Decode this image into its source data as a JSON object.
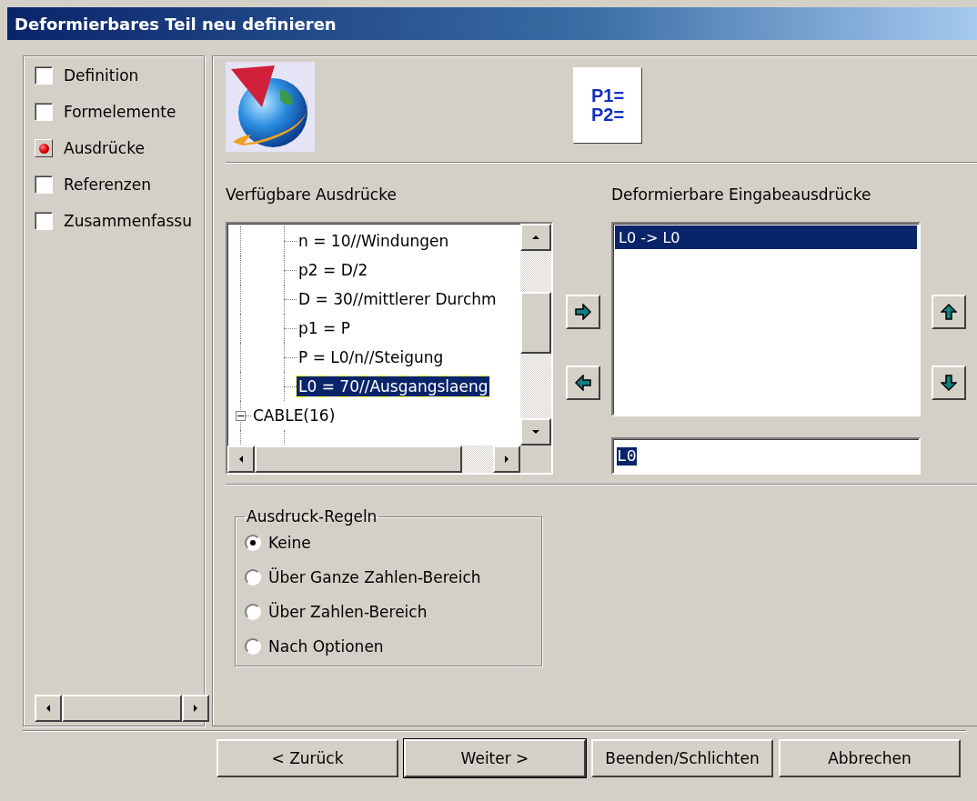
{
  "window": {
    "title": "Deformierbares Teil neu definieren"
  },
  "parameter_icon": [
    "P1=",
    "P2="
  ],
  "steps": [
    {
      "label": "Definition",
      "selected": false
    },
    {
      "label": "Formelemente",
      "selected": false
    },
    {
      "label": "Ausdrücke",
      "selected": true
    },
    {
      "label": "Referenzen",
      "selected": false
    },
    {
      "label": "Zusammenfassu",
      "selected": false
    }
  ],
  "available": {
    "label": "Verfügbare Ausdrücke",
    "items": [
      {
        "children": [
          {
            "label": "n = 10//Windungen",
            "selected": false
          },
          {
            "label": "p2 = D/2",
            "selected": false
          },
          {
            "label": "D = 30//mittlerer Durchm",
            "selected": false
          },
          {
            "label": "p1 = P",
            "selected": false
          },
          {
            "label": "P = L0/n//Steigung",
            "selected": false
          },
          {
            "label": "L0 = 70//Ausgangslaeng",
            "selected": true
          }
        ]
      },
      {
        "label": "CABLE(16)",
        "expanded": true,
        "selected": false
      }
    ]
  },
  "inputs": {
    "label": "Deformierbare Eingabeausdrücke",
    "items": [
      {
        "label": "L0 -> L0",
        "selected": true
      }
    ],
    "value": "L0"
  },
  "rules": {
    "title": "Ausdruck-Regeln",
    "options": [
      {
        "label": "Keine",
        "selected": true
      },
      {
        "label": "Über Ganze Zahlen-Bereich",
        "selected": false
      },
      {
        "label": "Über Zahlen-Bereich",
        "selected": false
      },
      {
        "label": "Nach Optionen",
        "selected": false
      }
    ]
  },
  "buttons": [
    {
      "label": "< Zurück",
      "default": false
    },
    {
      "label": "Weiter >",
      "default": true
    },
    {
      "label": "Beenden/Schlichten",
      "default": false
    },
    {
      "label": "Abbrechen",
      "default": false
    }
  ]
}
